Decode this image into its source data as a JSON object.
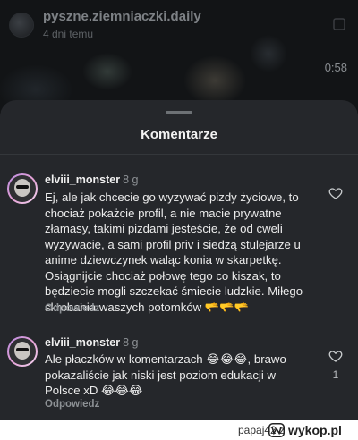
{
  "post": {
    "author": "pyszne.ziemniaczki.daily",
    "time": "4 dni temu",
    "video_time": "0:58"
  },
  "comments_sheet": {
    "title": "Komentarze",
    "comments": [
      {
        "username": "elviii_monster",
        "age": "8 g",
        "text": "Ej, ale jak chcecie go wyzywać pizdy życiowe, to chociaż pokażcie profil, a nie macie prywatne złamasy, takimi pizdami jesteście, że od cweli wyzywacie, a sami profil priv i siedzą stulejarze u anime dziewczynek waląc konia w skarpetkę. Osiągnijcie chociaż połowę tego co kiszak, to będziecie mogli szczekać śmiecie ludzkie. Miłego skrobania waszych potomków 🫳🫳🫳",
        "reply_label": "Odpowiedz",
        "likes": ""
      },
      {
        "username": "elviii_monster",
        "age": "8 g",
        "text": "Ale płaczków w komentarzach 😂😂😂, brawo pokazaliście jak niski jest poziom edukacji w Polsce xD 😂😂😂",
        "reply_label": "Odpowiedz",
        "likes": "1"
      }
    ]
  },
  "footer": {
    "user": "papaj42",
    "connector": "z",
    "site": "wykop.pl"
  },
  "icons": {
    "more": "more-icon",
    "heart": "heart-icon",
    "logo": "wykop-logo-icon"
  },
  "colors": {
    "sheet_bg": "#25272b",
    "avatar_ring": "#e4a1d6"
  }
}
